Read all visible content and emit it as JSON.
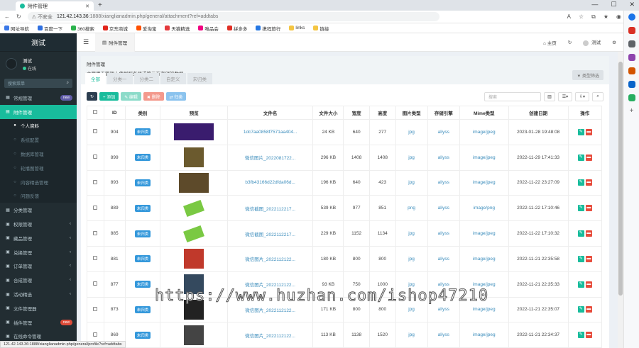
{
  "browser": {
    "tab_title": "附件管理",
    "insecure": "不安全",
    "url_host": "121.42.143.36",
    "url_rest": ":1888/xianglianadmin.php/general/attachment?ref=addtabs",
    "bookmarks": [
      "网址导航",
      "百度一下",
      "360搜索",
      "京东商城",
      "爱淘宝",
      "天猫精选",
      "唯品会",
      "拼多多",
      "携程旅行",
      "links",
      "链接"
    ],
    "status_url": "121.42.143.36:1888/xianglianadmin.php/general/profile?ref=addtabs"
  },
  "sidebar": {
    "logo": "测试",
    "username": "测试",
    "status": "在线",
    "search_placeholder": "搜索菜单",
    "items": [
      {
        "label": "常规管理",
        "icon": "▦",
        "badge": "new",
        "badge_color": "#605ca8",
        "type": "top"
      },
      {
        "label": "附件管理",
        "icon": "▤",
        "type": "active"
      },
      {
        "label": "个人资料",
        "icon": "●",
        "type": "sub-cur"
      },
      {
        "label": "系统配置",
        "icon": "○",
        "type": "sub"
      },
      {
        "label": "数据库管理",
        "icon": "○",
        "type": "sub"
      },
      {
        "label": "轮播图管理",
        "icon": "○",
        "type": "sub"
      },
      {
        "label": "内容精选管理",
        "icon": "○",
        "type": "sub"
      },
      {
        "label": "问题反馈",
        "icon": "○",
        "type": "sub"
      },
      {
        "label": "分类管理",
        "icon": "▦",
        "type": "top"
      },
      {
        "label": "权限管理",
        "icon": "▣",
        "chev": "‹",
        "type": "top"
      },
      {
        "label": "藏品管理",
        "icon": "▣",
        "chev": "‹",
        "type": "top"
      },
      {
        "label": "兑换管理",
        "icon": "▣",
        "chev": "‹",
        "type": "top"
      },
      {
        "label": "订单管理",
        "icon": "▣",
        "chev": "‹",
        "type": "top"
      },
      {
        "label": "合成管理",
        "icon": "▣",
        "chev": "‹",
        "type": "top"
      },
      {
        "label": "活动精选",
        "icon": "▣",
        "chev": "‹",
        "type": "top"
      },
      {
        "label": "文件管理器",
        "icon": "▣",
        "type": "top"
      },
      {
        "label": "插件管理",
        "icon": "▣",
        "badge": "new",
        "badge_color": "#dd4b39",
        "type": "top"
      },
      {
        "label": "在线命令管理",
        "icon": "▣",
        "type": "top"
      }
    ]
  },
  "topnav": {
    "tab": "附件管理",
    "home": "主页",
    "user": "测试"
  },
  "panel": {
    "title": "附件管理",
    "desc": "主要用于管理上传到服务器或第三方存储的数据",
    "tabs": [
      "全部",
      "分类一",
      "分类二",
      "自定义",
      "未归类"
    ],
    "filter": "▼ 类型筛选",
    "btn_add": "+ 添加",
    "btn_edit": "✎ 编辑",
    "btn_del": "✖ 删除",
    "btn_classify": "⇄ 归类",
    "search_placeholder": "搜索"
  },
  "table": {
    "headers": [
      "",
      "ID",
      "类别",
      "预览",
      "文件名",
      "文件大小",
      "宽度",
      "高度",
      "图片类型",
      "存储引擎",
      "Mime类型",
      "创建日期",
      "操作"
    ],
    "rows": [
      {
        "id": "904",
        "cat": "未归类",
        "file": "1dc7aa0858f7571aa404...",
        "size": "24 KB",
        "w": "640",
        "h": "277",
        "type": "jpg",
        "engine": "aliyss",
        "mime": "image/jpeg",
        "date": "2023-01-28 19:48:08",
        "thumb": "#3a1c6e"
      },
      {
        "id": "899",
        "cat": "未归类",
        "file": "微信图片_2022081722...",
        "size": "296 KB",
        "w": "1408",
        "h": "1408",
        "type": "jpg",
        "engine": "aliyss",
        "mime": "image/jpeg",
        "date": "2022-11-29 17:41:33",
        "thumb": "#6b5a2e"
      },
      {
        "id": "893",
        "cat": "未归类",
        "file": "b3fb43166d22dfda06d...",
        "size": "196 KB",
        "w": "640",
        "h": "423",
        "type": "jpg",
        "engine": "aliyss",
        "mime": "image/jpeg",
        "date": "2022-11-22 23:27:09",
        "thumb": "#5d4a2a"
      },
      {
        "id": "889",
        "cat": "未归类",
        "file": "微信截图_2022112217...",
        "size": "539 KB",
        "w": "977",
        "h": "851",
        "type": "png",
        "engine": "aliyss",
        "mime": "image/png",
        "date": "2022-11-22 17:10:46",
        "thumb": "#7ac943"
      },
      {
        "id": "885",
        "cat": "未归类",
        "file": "微信截图_2022112217...",
        "size": "229 KB",
        "w": "1152",
        "h": "1134",
        "type": "jpg",
        "engine": "aliyss",
        "mime": "image/jpeg",
        "date": "2022-11-22 17:10:32",
        "thumb": "#7ac943"
      },
      {
        "id": "881",
        "cat": "未归类",
        "file": "微信图片_2022112122...",
        "size": "180 KB",
        "w": "800",
        "h": "800",
        "type": "jpg",
        "engine": "aliyss",
        "mime": "image/jpeg",
        "date": "2022-11-21 22:35:58",
        "thumb": "#c0392b"
      },
      {
        "id": "877",
        "cat": "未归类",
        "file": "微信图片_2022112122...",
        "size": "93 KB",
        "w": "750",
        "h": "1000",
        "type": "jpg",
        "engine": "aliyss",
        "mime": "image/jpeg",
        "date": "2022-11-21 22:35:33",
        "thumb": "#34495e"
      },
      {
        "id": "873",
        "cat": "未归类",
        "file": "微信图片_2022112122...",
        "size": "171 KB",
        "w": "800",
        "h": "800",
        "type": "jpg",
        "engine": "aliyss",
        "mime": "image/jpeg",
        "date": "2022-11-21 22:35:07",
        "thumb": "#222222"
      },
      {
        "id": "869",
        "cat": "未归类",
        "file": "微信图片_2022112122...",
        "size": "113 KB",
        "w": "1138",
        "h": "1520",
        "type": "jpg",
        "engine": "aliyss",
        "mime": "image/jpeg",
        "date": "2022-11-21 22:34:37",
        "thumb": "#444444"
      }
    ]
  },
  "watermark": "https://www.huzhan.com/ishop47210"
}
